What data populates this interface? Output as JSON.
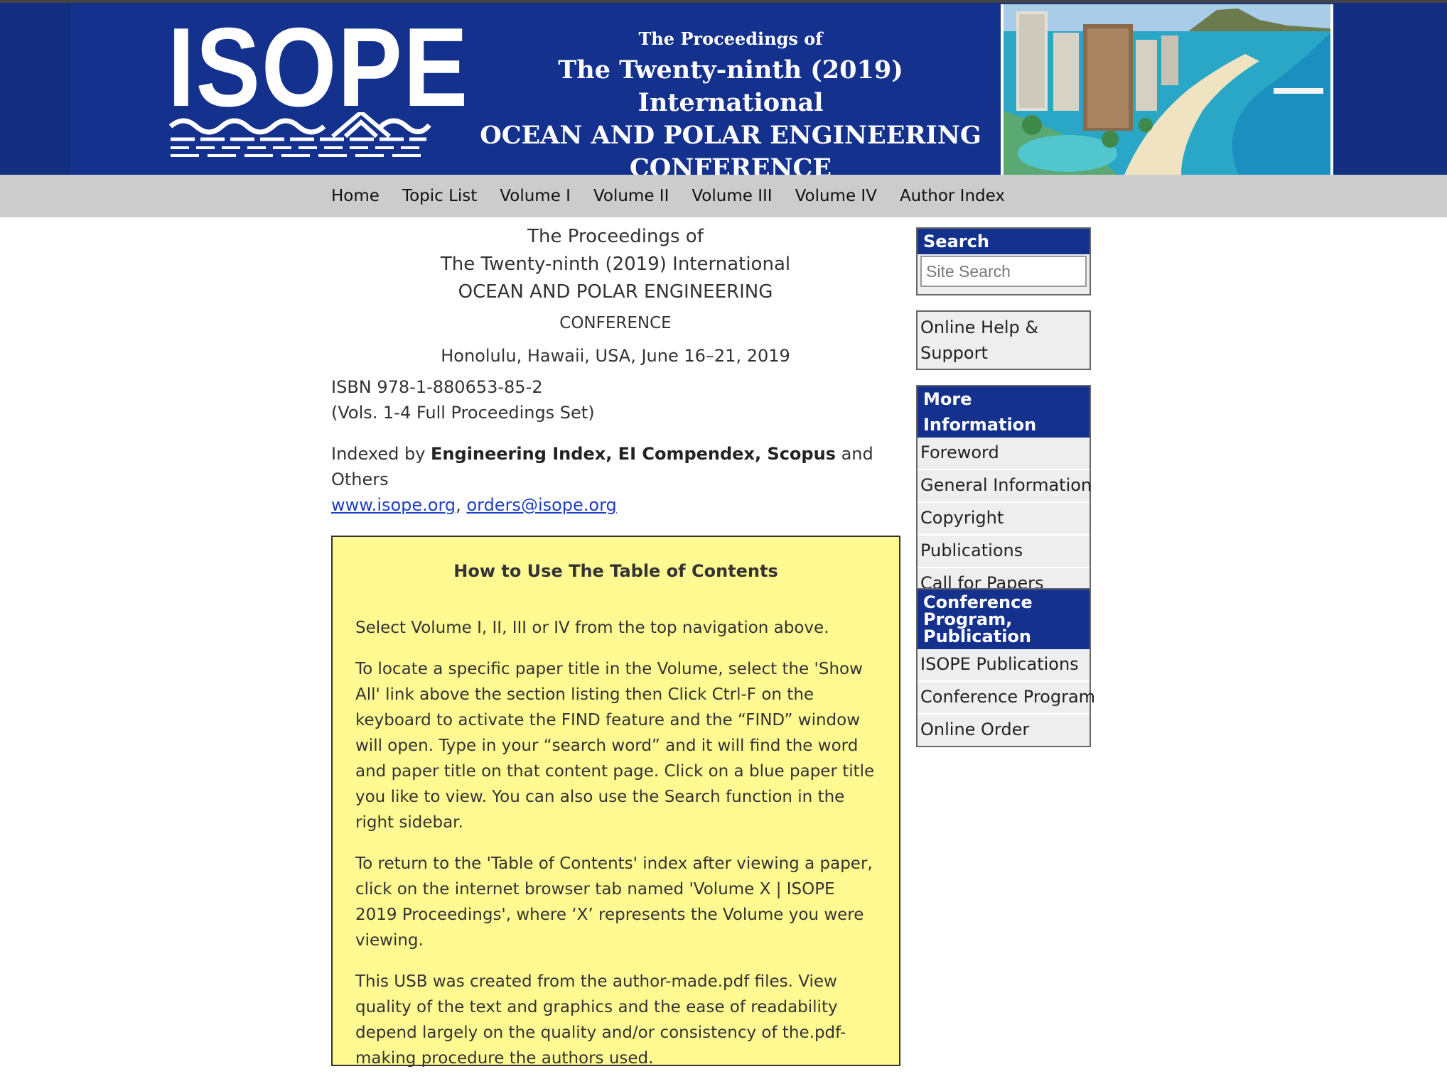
{
  "banner": {
    "logo_text": "ISOPE",
    "pre_title": "The Proceedings of",
    "title_line1": "The Twenty-ninth (2019) International",
    "title_line2": "OCEAN AND POLAR ENGINEERING",
    "title_line3": "CONFERENCE",
    "photo_icon": "honolulu-beach-photo"
  },
  "nav": {
    "items": [
      "Home",
      "Topic List",
      "Volume I",
      "Volume II",
      "Volume III",
      "Volume IV",
      "Author Index"
    ]
  },
  "main": {
    "line1": "The Proceedings of",
    "line2": "The Twenty-ninth (2019) International",
    "line3": "OCEAN AND POLAR ENGINEERING",
    "line4": "CONFERENCE",
    "location": "Honolulu, Hawaii, USA, June 16–21, 2019",
    "isbn": "ISBN 978-1-880653-85-2",
    "set_note": "(Vols. 1-4 Full Proceedings Set)",
    "indexed_prefix": "Indexed by ",
    "indexed_bold": "Engineering Index, EI Compendex, Scopus",
    "indexed_suffix": " and Others",
    "link_site": "www.isope.org",
    "link_sep": ", ",
    "link_email": "orders@isope.org"
  },
  "howto": {
    "title": "How to Use The Table of Contents",
    "p1": "Select Volume I, II, III or IV from the top navigation above.",
    "p2": "To locate a specific paper title in the Volume, select the 'Show All' link above the section listing then Click Ctrl-F on the keyboard to activate the FIND feature and the “FIND” window will open. Type in your “search word” and it will find the word and paper title on that content page. Click on a blue paper title you like to view. You can also use the Search function in the right sidebar.",
    "p3": "To return to the 'Table of Contents' index after viewing a paper, click on the internet browser tab named 'Volume X | ISOPE 2019 Proceedings', where ‘X’ represents the Volume you were viewing.",
    "p4": "This USB was created from the author-made.pdf files. View quality of the text and graphics and the ease of readability depend largely on the quality and/or consistency of the.pdf-making procedure the authors used."
  },
  "sidebar": {
    "search_title": "Search",
    "search_placeholder": "Site Search",
    "help_link": "Online Help & Support",
    "more_title": "More Information",
    "more_items": [
      "Foreword",
      "General Information",
      "Copyright",
      "Publications",
      "Call for Papers"
    ],
    "conf_title": "Conference Program, Publication",
    "conf_items": [
      "ISOPE Publications",
      "Conference Program",
      "Online Order"
    ]
  },
  "colors": {
    "banner_blue": "#14318d",
    "nav_gray": "#cccccc",
    "notice_yellow": "#fff992",
    "link_blue": "#1c3fc4"
  }
}
